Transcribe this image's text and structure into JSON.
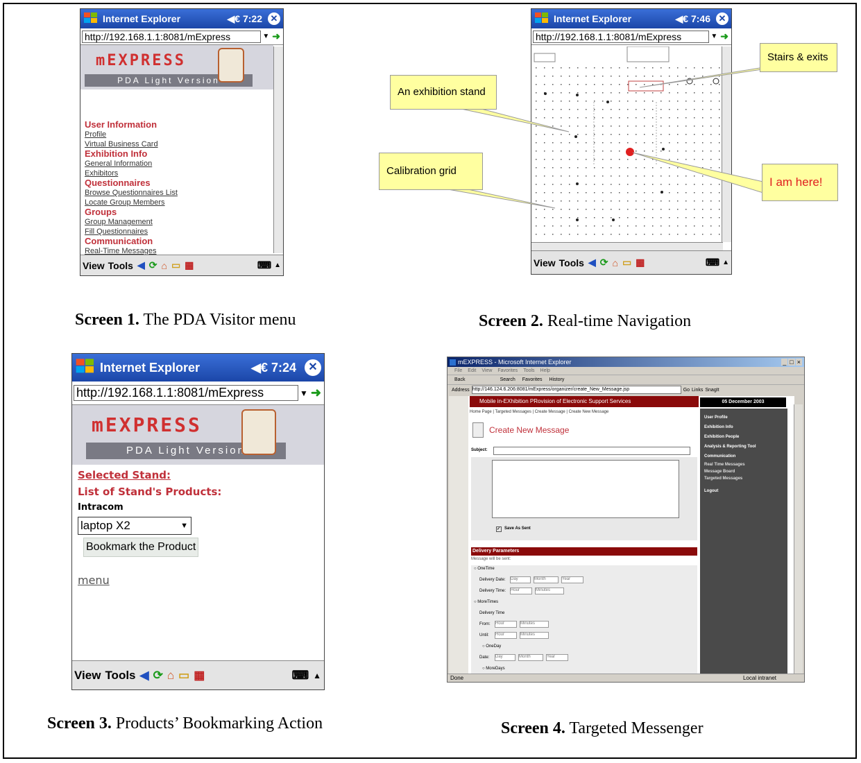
{
  "screen1": {
    "title": "Internet Explorer",
    "time": "◀€ 7:22",
    "url": "http://192.168.1.1:8081/mExpress",
    "logo_brand": "mEXPRESS",
    "logo_sub": "PDA Light Version",
    "menu": [
      {
        "heading": "User Information",
        "links": [
          "Profile",
          "Virtual Business Card"
        ]
      },
      {
        "heading": "Exhibition Info",
        "links": [
          "General Information",
          "Exhibitors"
        ]
      },
      {
        "heading": "Questionnaires",
        "links": [
          "Browse Questionnaires List",
          "Locate Group Members"
        ]
      },
      {
        "heading": "Groups",
        "links": [
          "Group Management",
          "Fill Questionnaires"
        ]
      },
      {
        "heading": "Communication",
        "links": [
          "Real-Time Messages"
        ]
      }
    ],
    "toolbar_view": "View",
    "toolbar_tools": "Tools",
    "caption_bold": "Screen 1.",
    "caption_text": " The PDA Visitor menu"
  },
  "screen2": {
    "title": "Internet Explorer",
    "time": "◀€ 7:46",
    "url": "http://192.168.1.1:8081/mExpress",
    "callouts": [
      "Stairs & exits",
      "An exhibition stand",
      "Calibration grid",
      "I am here!"
    ],
    "toolbar_view": "View",
    "toolbar_tools": "Tools",
    "caption_bold": "Screen 2.",
    "caption_text": " Real-time Navigation"
  },
  "screen3": {
    "title": "Internet Explorer",
    "time": "◀€ 7:24",
    "url": "http://192.168.1.1:8081/mExpress",
    "logo_brand": "mEXPRESS",
    "logo_sub": "PDA Light Version",
    "selected_stand": "Selected Stand:",
    "list_products": "List of Stand's Products:",
    "company": "Intracom",
    "product_value": "laptop X2",
    "bookmark_button": "Bookmark the Product",
    "menu_link": "menu",
    "toolbar_view": "View",
    "toolbar_tools": "Tools",
    "caption_bold": "Screen 3.",
    "caption_text": " Products’ Bookmarking Action"
  },
  "screen4": {
    "window_title": "mEXPRESS - Microsoft Internet Explorer",
    "menubar": [
      "File",
      "Edit",
      "View",
      "Favorites",
      "Tools",
      "Help"
    ],
    "toolbar": [
      "Back",
      "Search",
      "Favorites",
      "History"
    ],
    "address_label": "Address",
    "address_url": "http://146.124.6.206:8081/mExpress/organizer/create_New_Message.jsp",
    "go_label": "Go",
    "links_label": "Links",
    "snagit_label": "SnagIt",
    "banner": "Mobile in-EXhibition PRovision of Electronic Support Services",
    "date": "05 December 2003",
    "breadcrumb": "Home Page | Targeted Messages | Create Message | Create New Message",
    "page_title": "Create New Message",
    "subject_label": "Subject:",
    "save_as_sent": "Save As Sent",
    "delivery_header": "Delivery Parameters",
    "message_will_be_sent": "Message will be sent:",
    "one_time": "OneTime",
    "delivery_date": "Delivery Date:",
    "day": "Day",
    "month": "Month",
    "year": "Year",
    "delivery_time": "Delivery Time:",
    "hour": "Hour",
    "minutes": "Minutes",
    "more_times": "MoreTimes",
    "delivery_time2": "Delivery Time",
    "from": "From:",
    "until": "Until:",
    "one_day": "OneDay",
    "date_label": "Date:",
    "more_days": "MoreDays",
    "side_menu": [
      "User Profile",
      "Exhibition Info",
      "Exhibition People",
      "Analysis & Reporting Tool",
      "Communication",
      "Real Time Messages",
      "Message Board",
      "Targeted Messages",
      "Logout"
    ],
    "status_done": "Done",
    "status_zone": "Local intranet",
    "caption_bold": "Screen 4.",
    "caption_text": " Targeted Messenger"
  }
}
